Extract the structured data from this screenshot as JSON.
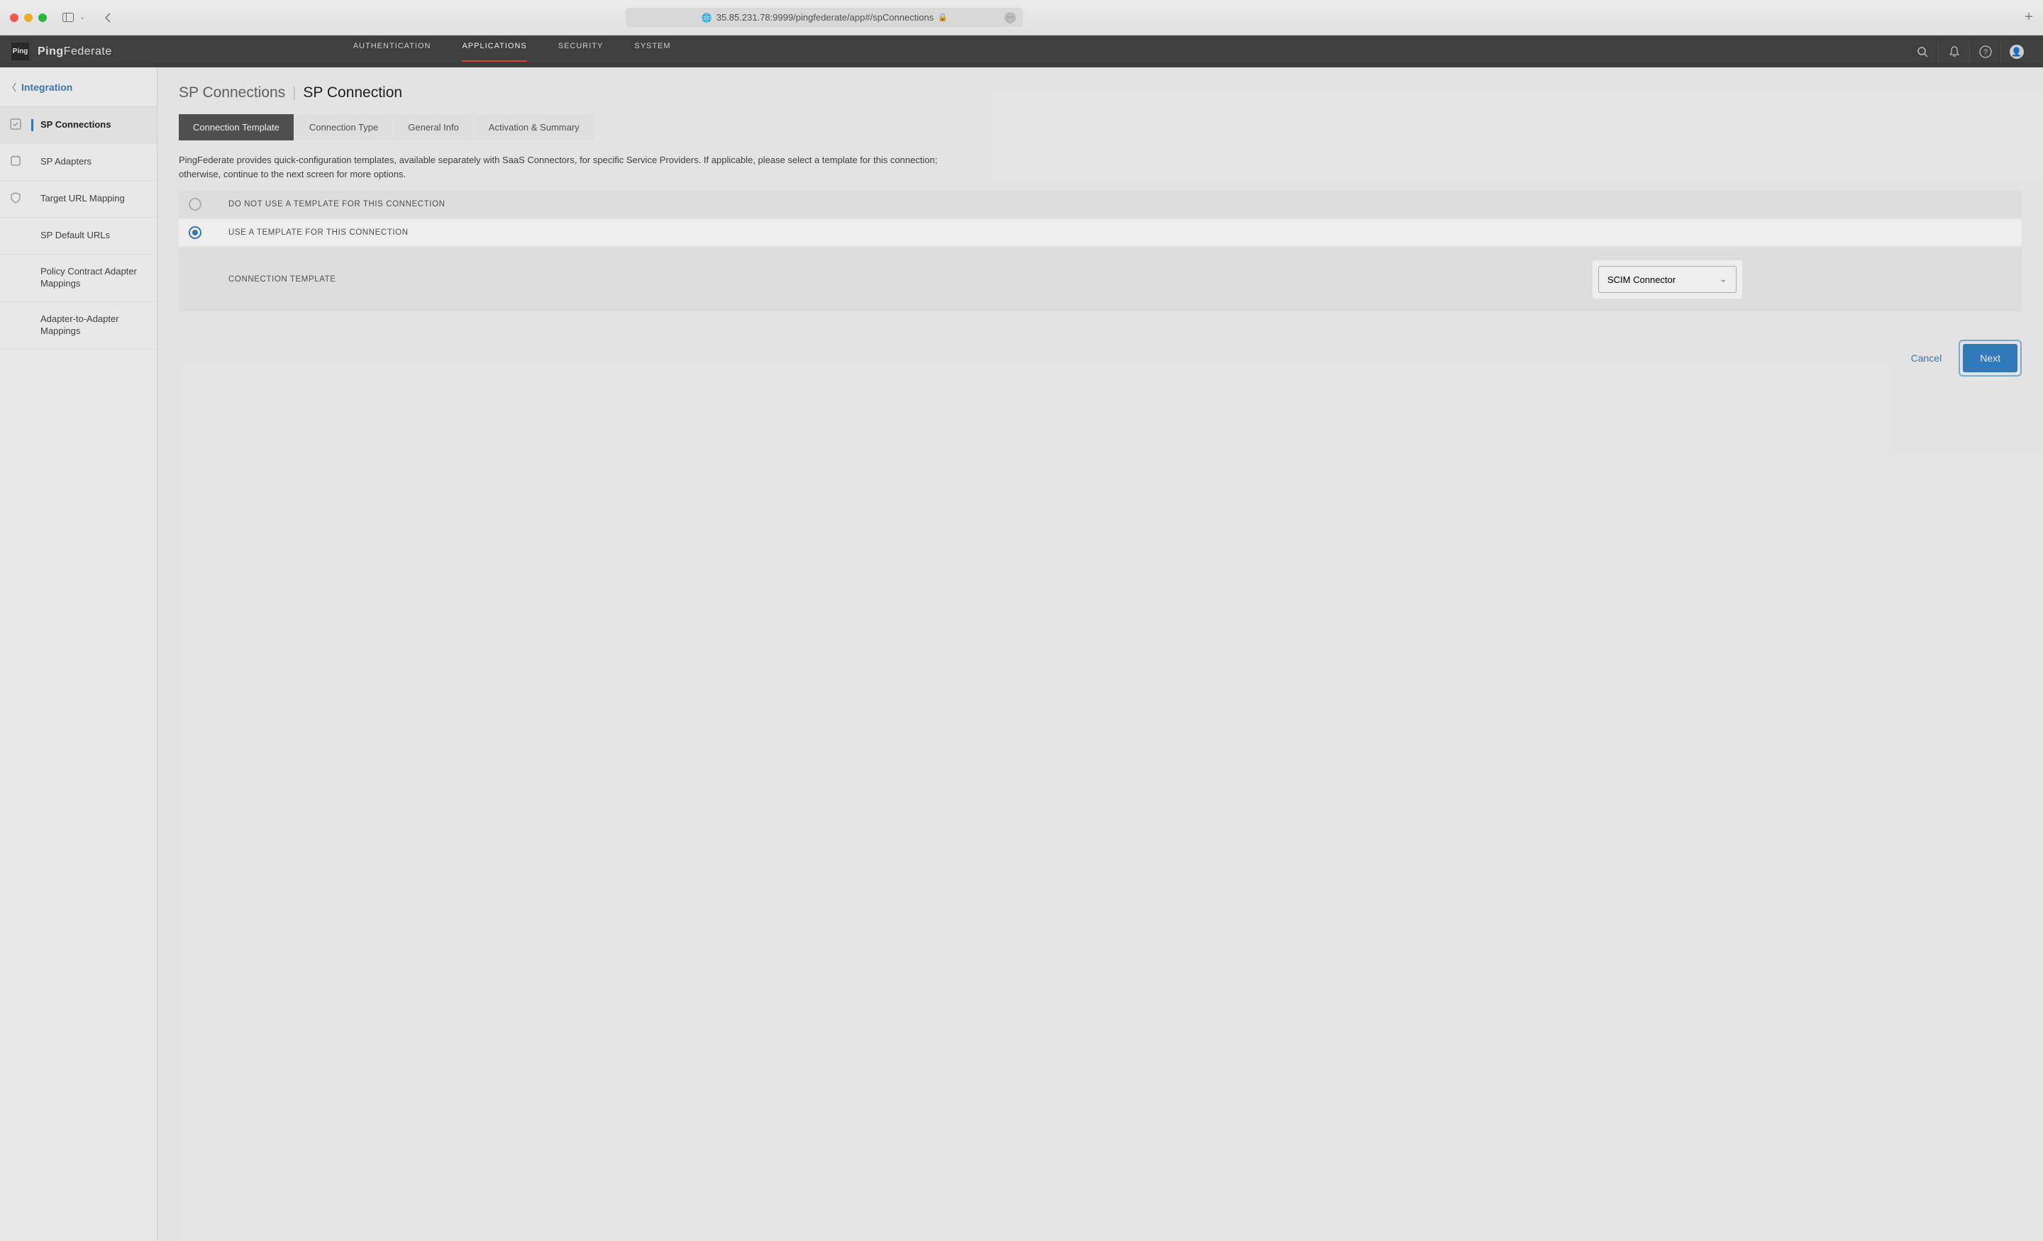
{
  "browser": {
    "url": "35.85.231.78:9999/pingfederate/app#/spConnections"
  },
  "header": {
    "logo_prefix": "Ping",
    "logo_suffix": "Federate",
    "nav": [
      "AUTHENTICATION",
      "APPLICATIONS",
      "SECURITY",
      "SYSTEM"
    ],
    "nav_active_index": 1
  },
  "sidebar": {
    "title": "Integration",
    "items": [
      "SP Connections",
      "SP Adapters",
      "Target URL Mapping",
      "SP Default URLs",
      "Policy Contract Adapter Mappings",
      "Adapter-to-Adapter Mappings"
    ],
    "active_index": 0
  },
  "main": {
    "crumb_parent": "SP Connections",
    "crumb_current": "SP Connection",
    "tabs": [
      "Connection Template",
      "Connection Type",
      "General Info",
      "Activation & Summary"
    ],
    "tabs_active_index": 0,
    "description": "PingFederate provides quick-configuration templates, available separately with SaaS Connectors, for specific Service Providers. If applicable, please select a template for this connection; otherwise, continue to the next screen for more options.",
    "options": [
      "DO NOT USE A TEMPLATE FOR THIS CONNECTION",
      "USE A TEMPLATE FOR THIS CONNECTION"
    ],
    "selected_option_index": 1,
    "template_label": "CONNECTION TEMPLATE",
    "template_selected": "SCIM Connector",
    "cancel_label": "Cancel",
    "next_label": "Next"
  }
}
